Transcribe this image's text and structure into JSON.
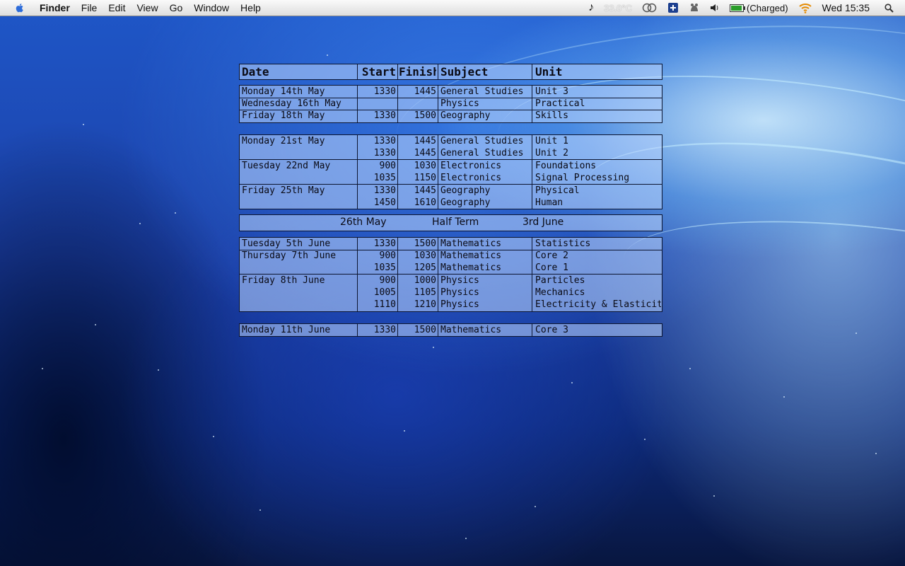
{
  "menubar": {
    "app": "Finder",
    "menus": [
      "File",
      "Edit",
      "View",
      "Go",
      "Window",
      "Help"
    ],
    "status": {
      "temperature": "33.0°C",
      "battery": "(Charged)",
      "clock": "Wed 15:35"
    },
    "icons": [
      "apple-icon",
      "music-note-icon",
      "sync-icon",
      "dashboard-icon",
      "growl-icon",
      "volume-icon",
      "battery-icon",
      "wifi-icon",
      "spotlight-icon"
    ]
  },
  "timetable": {
    "headers": {
      "date": "Date",
      "start": "Start",
      "finish": "Finish",
      "subject": "Subject",
      "unit": "Unit"
    },
    "blocks": [
      {
        "rows": [
          {
            "date": "Monday 14th May",
            "start": "1330",
            "finish": "1445",
            "subject": "General Studies",
            "unit": "Unit 3"
          },
          {
            "date": "Wednesday 16th May",
            "start": "",
            "finish": "",
            "subject": "Physics",
            "unit": "Practical"
          },
          {
            "date": "Friday 18th May",
            "start": "1330",
            "finish": "1500",
            "subject": "Geography",
            "unit": "Skills"
          }
        ]
      },
      {
        "rows": [
          {
            "date": "Monday 21st May",
            "start": "1330",
            "finish": "1445",
            "subject": "General Studies",
            "unit": "Unit 1"
          },
          {
            "date": "",
            "start": "1330",
            "finish": "1445",
            "subject": "General Studies",
            "unit": "Unit 2"
          },
          {
            "date": "Tuesday 22nd May",
            "start": "900",
            "finish": "1030",
            "subject": "Electronics",
            "unit": "Foundations"
          },
          {
            "date": "",
            "start": "1035",
            "finish": "1150",
            "subject": "Electronics",
            "unit": "Signal Processing"
          },
          {
            "date": "Friday 25th May",
            "start": "1330",
            "finish": "1445",
            "subject": "Geography",
            "unit": "Physical"
          },
          {
            "date": "",
            "start": "1450",
            "finish": "1610",
            "subject": "Geography",
            "unit": "Human"
          }
        ]
      },
      {
        "rows": [
          {
            "date": "Tuesday 5th June",
            "start": "1330",
            "finish": "1500",
            "subject": "Mathematics",
            "unit": "Statistics"
          },
          {
            "date": "Thursday 7th June",
            "start": "900",
            "finish": "1030",
            "subject": "Mathematics",
            "unit": "Core 2"
          },
          {
            "date": "",
            "start": "1035",
            "finish": "1205",
            "subject": "Mathematics",
            "unit": "Core 1"
          },
          {
            "date": "Friday 8th June",
            "start": "900",
            "finish": "1000",
            "subject": "Physics",
            "unit": "Particles"
          },
          {
            "date": "",
            "start": "1005",
            "finish": "1105",
            "subject": "Physics",
            "unit": "Mechanics"
          },
          {
            "date": "",
            "start": "1110",
            "finish": "1210",
            "subject": "Physics",
            "unit": "Electricity & Elasticity"
          }
        ]
      },
      {
        "rows": [
          {
            "date": "Monday 11th June",
            "start": "1330",
            "finish": "1500",
            "subject": "Mathematics",
            "unit": "Core 3"
          }
        ]
      }
    ],
    "half_term": {
      "from": "26th May",
      "label": "Half Term",
      "to": "3rd June"
    }
  }
}
